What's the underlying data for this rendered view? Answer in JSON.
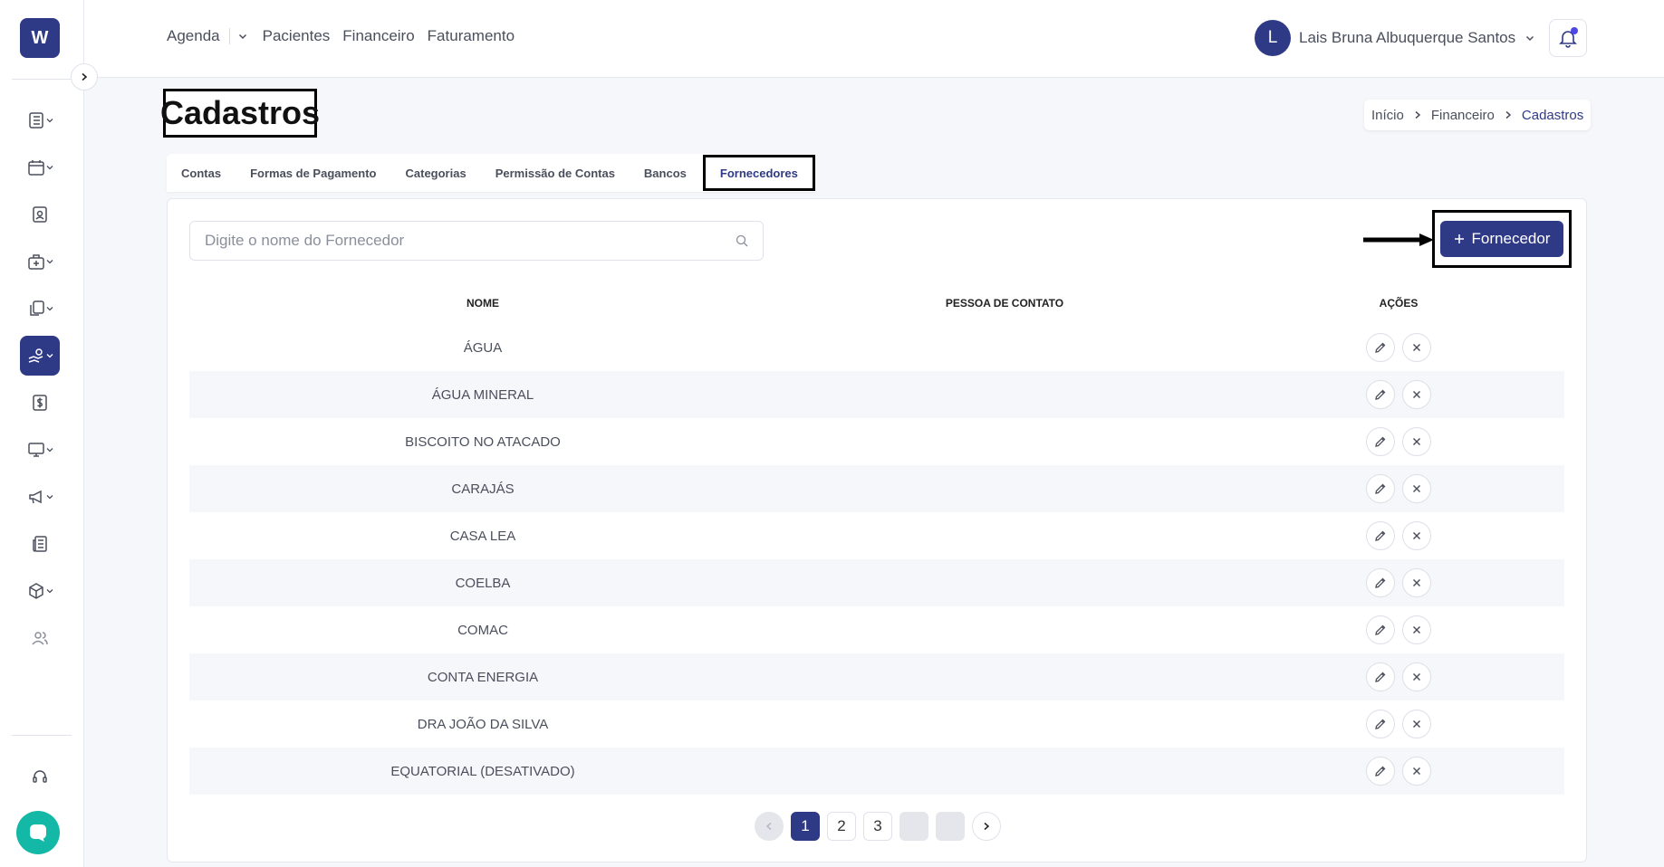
{
  "app": {
    "logo_letter": "W"
  },
  "top_nav": {
    "agenda": "Agenda",
    "pacientes": "Pacientes",
    "financeiro": "Financeiro",
    "faturamento": "Faturamento"
  },
  "user": {
    "initial": "L",
    "name": "Lais Bruna Albuquerque Santos"
  },
  "page": {
    "title": "Cadastros"
  },
  "breadcrumb": [
    "Início",
    "Financeiro",
    "Cadastros"
  ],
  "tabs": [
    "Contas",
    "Formas de Pagamento",
    "Categorias",
    "Permissão de Contas",
    "Bancos",
    "Fornecedores"
  ],
  "active_tab": "Fornecedores",
  "search": {
    "placeholder": "Digite o nome do Fornecedor",
    "value": ""
  },
  "add_button": {
    "label": "Fornecedor"
  },
  "table": {
    "headers": {
      "name": "NOME",
      "contact": "PESSOA DE CONTATO",
      "actions": "AÇÕES"
    },
    "rows": [
      {
        "name": "ÁGUA",
        "contact": ""
      },
      {
        "name": "ÁGUA MINERAL",
        "contact": ""
      },
      {
        "name": "BISCOITO NO ATACADO",
        "contact": ""
      },
      {
        "name": "CARAJÁS",
        "contact": ""
      },
      {
        "name": "CASA LEA",
        "contact": ""
      },
      {
        "name": "COELBA",
        "contact": ""
      },
      {
        "name": "COMAC",
        "contact": ""
      },
      {
        "name": "CONTA ENERGIA",
        "contact": ""
      },
      {
        "name": "DRA JOÃO DA SILVA",
        "contact": ""
      },
      {
        "name": "EQUATORIAL (DESATIVADO)",
        "contact": ""
      }
    ]
  },
  "pagination": {
    "pages": [
      "1",
      "2",
      "3"
    ],
    "current": "1"
  },
  "colors": {
    "primary": "#2f3a86",
    "chat": "#14b8a6",
    "notification_dot": "#4f46e5"
  }
}
